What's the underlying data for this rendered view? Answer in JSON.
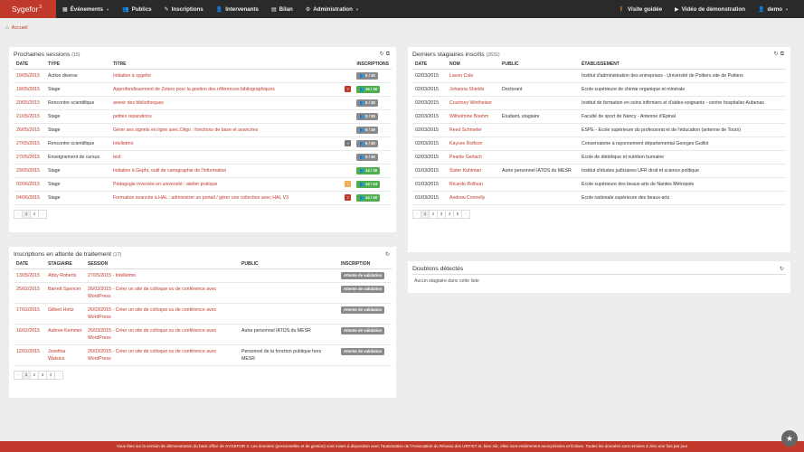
{
  "brand": {
    "name": "Sygefor",
    "sup": "3"
  },
  "nav": {
    "items": [
      {
        "label": "Événements",
        "icon": "calendar-icon",
        "glyph": "▦",
        "dropdown": true
      },
      {
        "label": "Publics",
        "icon": "users-icon",
        "glyph": "👥",
        "dropdown": false
      },
      {
        "label": "Inscriptions",
        "icon": "inscriptions-icon",
        "glyph": "✎",
        "dropdown": false
      },
      {
        "label": "Intervenants",
        "icon": "user-icon",
        "glyph": "👤",
        "dropdown": false
      },
      {
        "label": "Bilan",
        "icon": "chart-icon",
        "glyph": "▤",
        "dropdown": false
      },
      {
        "label": "Administration",
        "icon": "gear-icon",
        "glyph": "⚙",
        "dropdown": true
      }
    ],
    "right": {
      "visite": "Visite guidée",
      "video": "Vidéo de démonstration",
      "user": "demo"
    }
  },
  "breadcrumb": {
    "home": "Accueil"
  },
  "sessions": {
    "title": "Prochaines sessions",
    "count": "(15)",
    "headers": {
      "date": "DATE",
      "type": "TYPE",
      "titre": "TITRE",
      "inscriptions": "INSCRIPTIONS"
    },
    "rows": [
      {
        "date": "19/05/2015",
        "type": "Action diverse",
        "titre": "Initiation à sygefor",
        "mark": "",
        "badge": "0 / 30",
        "badgeColor": "grey"
      },
      {
        "date": "19/05/2015",
        "type": "Stage",
        "titre": "Approfondissement de Zotero pour la gestion des références bibliographiques",
        "mark": "red",
        "badge": "15 / 30",
        "badgeColor": "green"
      },
      {
        "date": "20/05/2015",
        "type": "Rencontre scientifique",
        "titre": "avenir des bibliotheques",
        "mark": "",
        "badge": "0 / 30",
        "badgeColor": "grey"
      },
      {
        "date": "21/05/2015",
        "type": "Stage",
        "titre": "petites reparations",
        "mark": "",
        "badge": "0 / 30",
        "badgeColor": "grey"
      },
      {
        "date": "26/05/2015",
        "type": "Stage",
        "titre": "Gérer ses signets en ligne avec Diigo : fonctions de base et avancées",
        "mark": "",
        "badge": "0 / 16",
        "badgeColor": "grey"
      },
      {
        "date": "27/05/2015",
        "type": "Rencontre scientifique",
        "titre": "Intelletmo",
        "mark": "grey",
        "badge": "0 / 30",
        "badgeColor": "grey"
      },
      {
        "date": "27/05/2015",
        "type": "Enseignement de cursus",
        "titre": "test",
        "mark": "",
        "badge": "0 / 30",
        "badgeColor": "grey"
      },
      {
        "date": "29/05/2015",
        "type": "Stage",
        "titre": "Initiation à Gephi, outil de cartographie de l'information",
        "mark": "",
        "badge": "14 / 30",
        "badgeColor": "green"
      },
      {
        "date": "02/06/2015",
        "type": "Stage",
        "titre": "Pédagogie inversée en université : atelier pratique",
        "mark": "orange",
        "badge": "14 / 24",
        "badgeColor": "green"
      },
      {
        "date": "04/06/2015",
        "type": "Stage",
        "titre": "Formation avancée à HAL : administrer un portail / gérer une collection avec HAL V3",
        "mark": "red",
        "badge": "14 / 20",
        "badgeColor": "green"
      }
    ],
    "pager": [
      "‹",
      "1",
      "2",
      "›"
    ]
  },
  "stagiaires": {
    "title": "Derniers stagiaires inscrits",
    "count": "(2631)",
    "headers": {
      "date": "DATE",
      "nom": "NOM",
      "public": "PUBLIC",
      "etab": "ÉTABLISSEMENT"
    },
    "rows": [
      {
        "date": "02/03/2015",
        "nom": "Lavon Cole",
        "public": "",
        "etab": "Institut d'administration des entreprises - Université de Poitiers site de Poitiers"
      },
      {
        "date": "02/03/2015",
        "nom": "Johanna Shields",
        "public": "Doctorant",
        "etab": "Ecole supérieure de chimie organique et minérale"
      },
      {
        "date": "02/03/2015",
        "nom": "Courtney Wintheiser",
        "public": "",
        "etab": "Institut de formation en soins infirmiers et d'aides-soignants - centre hospitalier Aubenas"
      },
      {
        "date": "02/03/2015",
        "nom": "Wilhelmine Boehm",
        "public": "Etudiant, stagiaire",
        "etab": "Faculté de sport de Nancy - Antenne d'Epinal"
      },
      {
        "date": "02/03/2015",
        "nom": "Reed Schmeler",
        "public": "",
        "etab": "ESPE - Ecole supérieure du professorat et de l'éducation (antenne de Tours)"
      },
      {
        "date": "02/03/2015",
        "nom": "Kaycee Rolfson",
        "public": "",
        "etab": "Conservatoire à rayonnement départemental Georges Guillot"
      },
      {
        "date": "02/03/2015",
        "nom": "Pearlie Gerlach",
        "public": "",
        "etab": "Ecole de diététique et nutrition humaine"
      },
      {
        "date": "01/03/2015",
        "nom": "Sister Kuhlman",
        "public": "Autre personnel IATOS du MESR",
        "etab": "Institut d'études judiciaires UFR droit et science politique"
      },
      {
        "date": "01/03/2015",
        "nom": "Ricardo Rolfson",
        "public": "",
        "etab": "Ecole supérieure des beaux-arts de Nantes Métropole"
      },
      {
        "date": "01/03/2015",
        "nom": "Andrew Connelly",
        "public": "",
        "etab": "Ecole nationale supérieure des beaux-arts"
      }
    ],
    "pager": [
      "‹",
      "1",
      "2",
      "3",
      "4",
      "5",
      "›"
    ]
  },
  "attente": {
    "title": "Inscriptions en attente de traitement",
    "count": "(17)",
    "headers": {
      "date": "DATE",
      "stagiaire": "STAGIAIRE",
      "session": "SESSION",
      "public": "PUBLIC",
      "inscription": "INSCRIPTION"
    },
    "rows": [
      {
        "date": "13/05/2015",
        "stagiaire": "Abby Roberts",
        "session": "27/05/2015 - Intelletmo",
        "public": "",
        "status": "Attente de validation"
      },
      {
        "date": "25/02/2015",
        "stagiaire": "Barrett Spencer",
        "session": "26/03/2015 - Créer un site de colloque ou de conférence avec WordPress",
        "public": "",
        "status": "Attente de validation"
      },
      {
        "date": "17/02/2015",
        "stagiaire": "Gilbert Hintz",
        "session": "26/03/2015 - Créer un site de colloque ou de conférence avec WordPress",
        "public": "",
        "status": "Attente de validation"
      },
      {
        "date": "16/02/2015",
        "stagiaire": "Aubree Kemmer",
        "session": "26/03/2015 - Créer un site de colloque ou de conférence avec WordPress",
        "public": "Autre personnel IATOS du MESR",
        "status": "Attente de validation"
      },
      {
        "date": "12/02/2015",
        "stagiaire": "Josefina Watsica",
        "session": "26/03/2015 - Créer un site de colloque ou de conférence avec WordPress",
        "public": "Personnel de la fonction publique hors MESR",
        "status": "Attente de validation"
      }
    ],
    "pager": [
      "‹",
      "1",
      "2",
      "3",
      "4",
      "›"
    ]
  },
  "doublons": {
    "title": "Doublons détectés",
    "empty": "Aucun stagiaire dans cette liste"
  },
  "footer": {
    "text": "Vous êtes sur la version de démonstration du back office de SYGEFOR 3. Les données (personnelles et de gestion) sont mises à disposition avec l'autorisation de l'Association du Réseau des URFIST et, bien sûr, elles sont entièrement anonymisées et fictives. Toutes les données sont remises à zéro une fois par jour"
  },
  "colors": {
    "brand": "#c0392b",
    "navbar": "#2a2a2a",
    "green": "#4cae4c",
    "grey": "#8a8a8a"
  }
}
